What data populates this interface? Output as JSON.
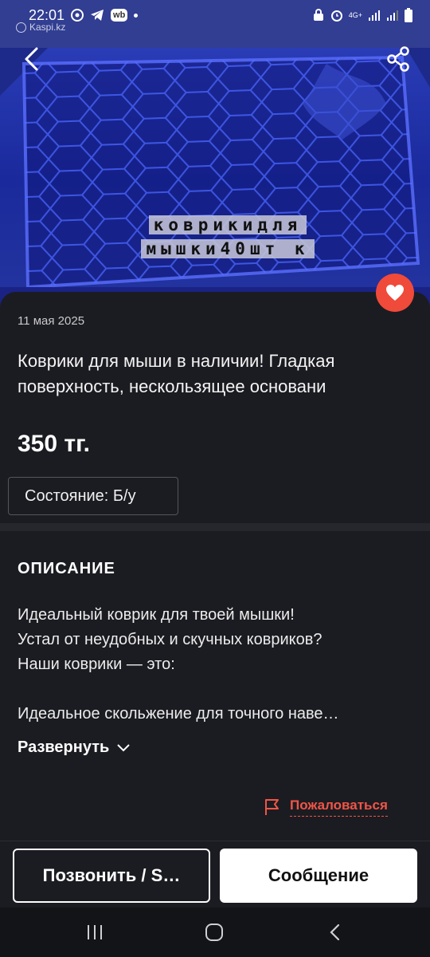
{
  "status_bar": {
    "time": "22:01",
    "left_icons": [
      "chrome-icon",
      "telegram-icon",
      "wb-icon",
      "dot-icon"
    ],
    "wb_label": "wb",
    "network": "4G+",
    "right_icons": [
      "lock-icon",
      "alarm-icon",
      "signal-icon",
      "signal-icon",
      "battery-icon"
    ]
  },
  "watermark": "Kaspi.kz",
  "image": {
    "overlay_line1": "коврикидля",
    "overlay_line2": "мышки40шт к"
  },
  "listing": {
    "date": "11 мая 2025",
    "title": "Коврики для мыши в наличии! Гладкая поверхность, нескользящее основани",
    "price": "350 тг.",
    "condition": "Состояние: Б/у"
  },
  "description": {
    "heading": "ОПИСАНИЕ",
    "lines": [
      "Идеальный коврик для твоей мышки!",
      "Устал от неудобных и скучных ковриков?",
      "Наши коврики — это:",
      "",
      "Идеальное скольжение для точного наве…"
    ],
    "expand_label": "Развернуть"
  },
  "report_label": "Пожаловаться",
  "actions": {
    "call_label": "Позвонить / S…",
    "message_label": "Сообщение"
  },
  "colors": {
    "background": "#1b1c21",
    "accent_red": "#f04a3a",
    "mat_blue": "#1f35c8"
  }
}
